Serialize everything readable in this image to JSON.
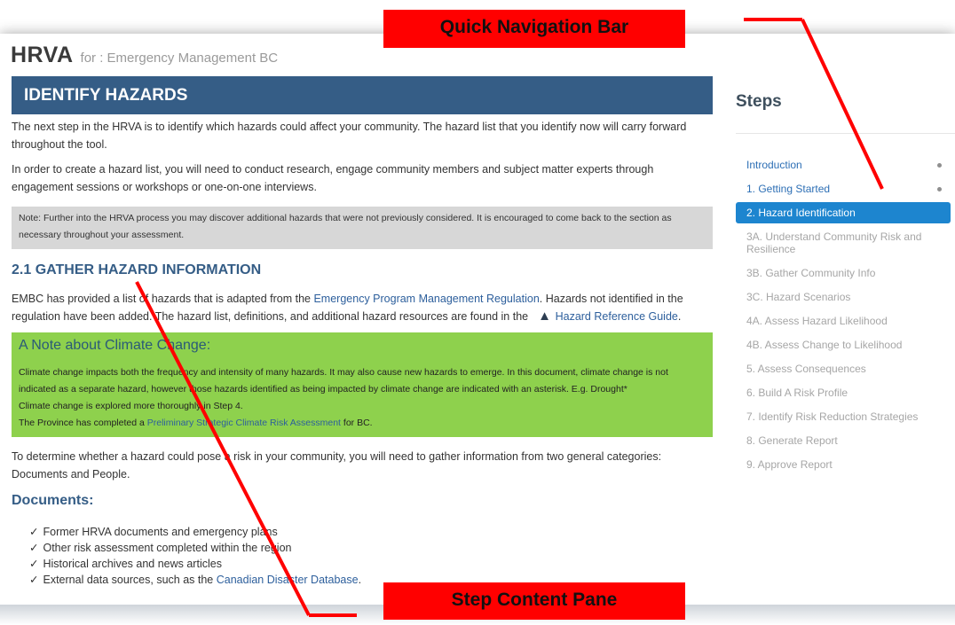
{
  "header": {
    "app_name": "HRVA",
    "subtitle": "for : Emergency Management BC"
  },
  "content": {
    "section_title": "IDENTIFY HAZARDS",
    "intro_p1": "The next step in the HRVA is to identify which hazards could affect your community. The hazard list that you identify now will carry forward throughout the tool.",
    "intro_p2": "In order to create a hazard list, you will need to conduct research, engage community members and subject matter experts through engagement sessions or workshops or one-on-one interviews.",
    "note": "Note: Further into the HRVA process you may discover additional hazards that were not previously considered. It is encouraged to come back to the section as necessary throughout your assessment.",
    "gather_title": "2.1 GATHER HAZARD INFORMATION",
    "gather_p_part1": "EMBC has provided a list of hazards that is adapted from the ",
    "gather_link1": "Emergency Program Management Regulation",
    "gather_p_part2": ". Hazards not identified in the regulation have been added. The hazard list, definitions, and additional hazard resources are found in the ",
    "gather_link2": "Hazard Reference Guide",
    "gather_p_part3": ".",
    "warning_icon": "warning-triangle-icon",
    "climate": {
      "title": "A Note about Climate Change:",
      "line1": "Climate change impacts both the frequency and intensity of many hazards. It may also cause new hazards to emerge. In this document, climate change is not indicated as a separate hazard, however those hazards identified as being impacted by climate change are indicated with an asterisk. E.g. Drought*",
      "line2": "Climate change is explored more thoroughly in Step 4.",
      "line3_part1": "The Province has completed a ",
      "line3_link": "Preliminary Strategic Climate Risk Assessment",
      "line3_part2": " for BC."
    },
    "determine_p": "To determine whether a hazard could pose a risk in your community, you will need to gather information from two general categories: Documents and People.",
    "docs_title": "Documents:",
    "docs": [
      "Former HRVA documents and emergency plans",
      "Other risk assessment completed within the region",
      "Historical archives and news articles"
    ],
    "docs_last_part1": "External data sources, such as the ",
    "docs_last_link": "Canadian Disaster Database",
    "docs_last_part2": ".",
    "check_glyph": "✓"
  },
  "steps": {
    "title": "Steps",
    "items": [
      {
        "label": "Introduction",
        "state": "done"
      },
      {
        "label": "1. Getting Started",
        "state": "done"
      },
      {
        "label": "2. Hazard Identification",
        "state": "active"
      },
      {
        "label": "3A. Understand Community Risk and Resilience",
        "state": "pending"
      },
      {
        "label": "3B. Gather Community Info",
        "state": "pending"
      },
      {
        "label": "3C. Hazard Scenarios",
        "state": "pending"
      },
      {
        "label": "4A. Assess Hazard Likelihood",
        "state": "pending"
      },
      {
        "label": "4B. Assess Change to Likelihood",
        "state": "pending"
      },
      {
        "label": "5. Assess Consequences",
        "state": "pending"
      },
      {
        "label": "6. Build A Risk Profile",
        "state": "pending"
      },
      {
        "label": "7. Identify Risk Reduction Strategies",
        "state": "pending"
      },
      {
        "label": "8. Generate Report",
        "state": "pending"
      },
      {
        "label": "9. Approve Report",
        "state": "pending"
      }
    ]
  },
  "callouts": {
    "nav": "Quick Navigation Bar",
    "content": "Step Content Pane"
  },
  "colors": {
    "header_bar": "#355d86",
    "active_step": "#1d85cf",
    "climate_box": "#8ed14d",
    "callout": "#ff0000"
  }
}
